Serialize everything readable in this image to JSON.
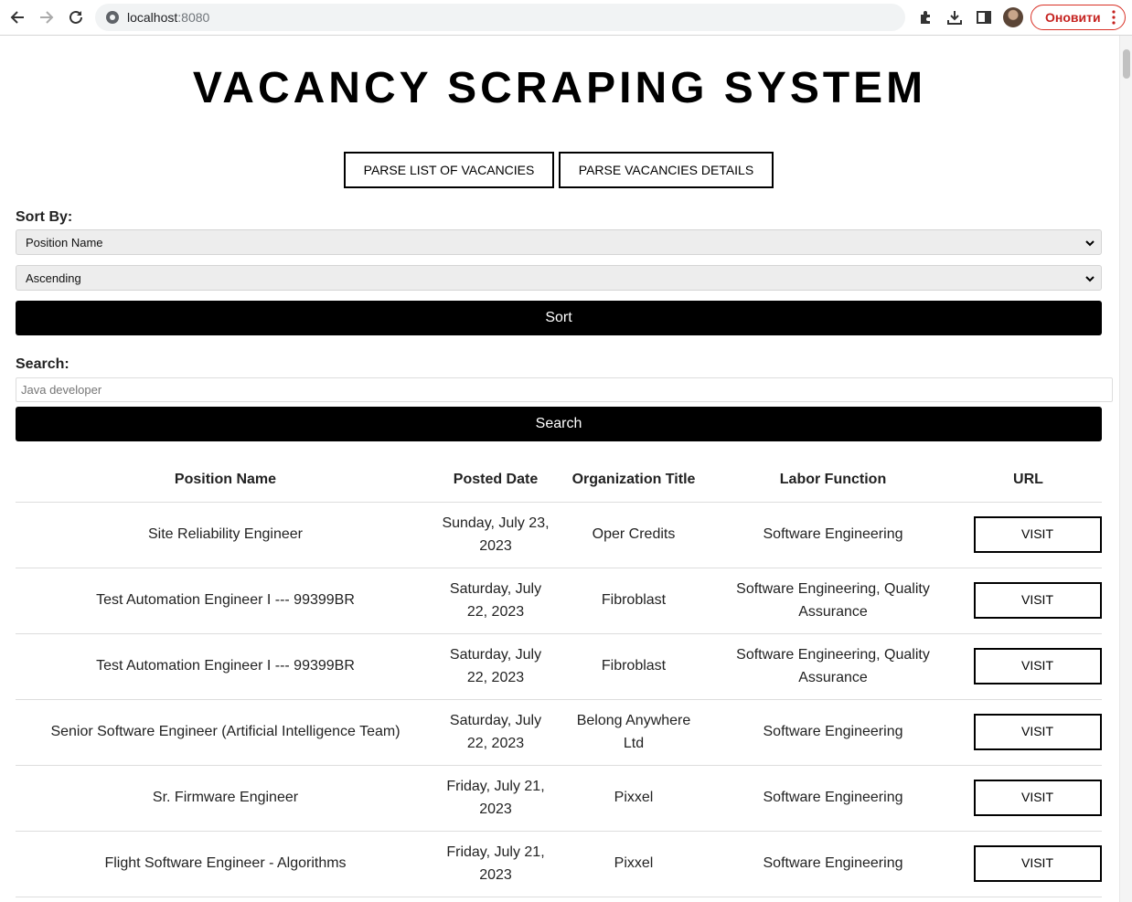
{
  "browser": {
    "url_host": "localhost",
    "url_port": ":8080",
    "update_label": "Оновити"
  },
  "page": {
    "title": "VACANCY SCRAPING SYSTEM",
    "parse_list_label": "PARSE LIST OF VACANCIES",
    "parse_details_label": "PARSE VACANCIES DETAILS",
    "sort_label": "Sort By:",
    "sort_field_value": "Position Name",
    "sort_order_value": "Ascending",
    "sort_button": "Sort",
    "search_label": "Search:",
    "search_placeholder": "Java developer",
    "search_button": "Search"
  },
  "table": {
    "headers": [
      "Position Name",
      "Posted Date",
      "Organization Title",
      "Labor Function",
      "URL"
    ],
    "rows": [
      {
        "position": "Site Reliability Engineer",
        "date": "Sunday, July 23, 2023",
        "org": "Oper Credits",
        "labor": "Software Engineering",
        "url_label": "VISIT"
      },
      {
        "position": "Test Automation Engineer I --- 99399BR",
        "date": "Saturday, July 22, 2023",
        "org": "Fibroblast",
        "labor": "Software Engineering, Quality Assurance",
        "url_label": "VISIT"
      },
      {
        "position": "Test Automation Engineer I --- 99399BR",
        "date": "Saturday, July 22, 2023",
        "org": "Fibroblast",
        "labor": "Software Engineering, Quality Assurance",
        "url_label": "VISIT"
      },
      {
        "position": "Senior Software Engineer (Artificial Intelligence Team)",
        "date": "Saturday, July 22, 2023",
        "org": "Belong Anywhere Ltd",
        "labor": "Software Engineering",
        "url_label": "VISIT"
      },
      {
        "position": "Sr. Firmware Engineer",
        "date": "Friday, July 21, 2023",
        "org": "Pixxel",
        "labor": "Software Engineering",
        "url_label": "VISIT"
      },
      {
        "position": "Flight Software Engineer - Algorithms",
        "date": "Friday, July 21, 2023",
        "org": "Pixxel",
        "labor": "Software Engineering",
        "url_label": "VISIT"
      }
    ]
  }
}
